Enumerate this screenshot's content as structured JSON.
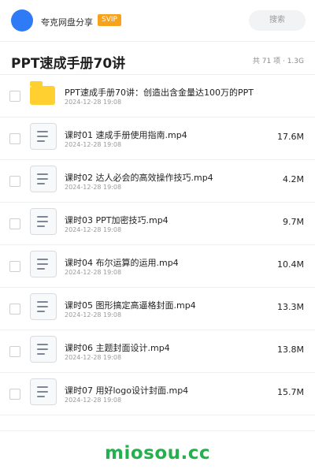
{
  "header": {
    "brand": "夸克网盘分享",
    "badge": "SVIP",
    "search_placeholder": "搜索"
  },
  "folder": {
    "title": "PPT速成手册70讲",
    "count_text": "共 71 项",
    "size_text": "1.3G"
  },
  "items": [
    {
      "type": "folder",
      "name": "PPT速成手册70讲：创造出含金量达100万的PPT",
      "date": "2024-12-28 19:08",
      "size": ""
    },
    {
      "type": "file",
      "name": "课时01 速成手册使用指南.mp4",
      "date": "2024-12-28 19:08",
      "size": "17.6M"
    },
    {
      "type": "file",
      "name": "课时02 达人必会的高效操作技巧.mp4",
      "date": "2024-12-28 19:08",
      "size": "4.2M"
    },
    {
      "type": "file",
      "name": "课时03 PPT加密技巧.mp4",
      "date": "2024-12-28 19:08",
      "size": "9.7M"
    },
    {
      "type": "file",
      "name": "课时04 布尔运算的运用.mp4",
      "date": "2024-12-28 19:08",
      "size": "10.4M"
    },
    {
      "type": "file",
      "name": "课时05 图形搞定高逼格封面.mp4",
      "date": "2024-12-28 19:08",
      "size": "13.3M"
    },
    {
      "type": "file",
      "name": "课时06 主题封面设计.mp4",
      "date": "2024-12-28 19:08",
      "size": "13.8M"
    },
    {
      "type": "file",
      "name": "课时07 用好logo设计封面.mp4",
      "date": "2024-12-28 19:08",
      "size": "15.7M"
    }
  ],
  "watermark": "miosou.cc",
  "colors": {
    "accent": "#2f7bf6",
    "badge": "#f7a21b",
    "folder": "#ffd030",
    "watermark": "#23b14d"
  }
}
